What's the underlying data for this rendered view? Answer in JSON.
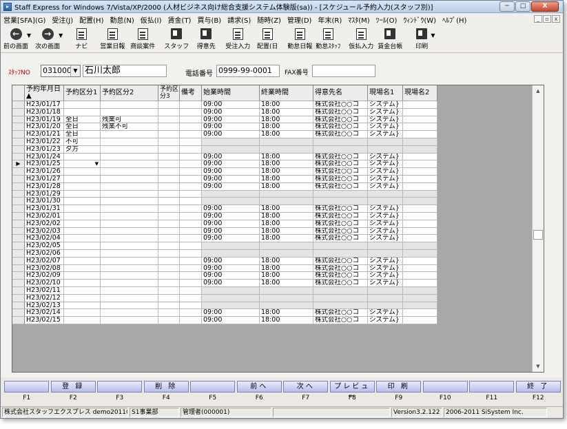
{
  "window": {
    "title": "Staff Express for Windows 7/Vista/XP/2000 (人材ビジネス向け総合支援システム体験版(sa)) - [スケジュール予約入力(スタッフ別)]",
    "controls": [
      "─",
      "□",
      "X"
    ]
  },
  "menubar": {
    "items": [
      "営業[SFA](G)",
      "受注(J)",
      "配置(H)",
      "勤怠(N)",
      "仮払(I)",
      "賃金(T)",
      "買与(B)",
      "請求(S)",
      "随時(Z)",
      "管理(D)",
      "年末(R)",
      "ﾏｽﾀ(M)",
      "ﾂｰﾙ(O)",
      "ｳｨﾝﾄﾞｳ(W)",
      "ﾍﾙﾌﾟ(H)"
    ],
    "mdi_controls": [
      "_",
      "▫",
      "x"
    ]
  },
  "toolbar": {
    "back": "前の画面",
    "forward": "次の画面",
    "navi": "ナビ",
    "sales_daily": "営業日報",
    "deal": "商談案件",
    "staff": "スタッフ",
    "customer": "得意先",
    "order_input": "受注入力",
    "placement": "配置(日",
    "attendance_daily": "勤怠日報",
    "attendance_staff": "勤怠ｽﾀｯﾌ",
    "advance_input": "仮払入力",
    "wage_ledger": "賃金台帳",
    "print": "印刷"
  },
  "form": {
    "staff_no_label": "ｽﾀｯﾌNO",
    "staff_no": "031000",
    "staff_name": "石川太郎",
    "tel_label": "電話番号",
    "tel": "0999-99-0001",
    "fax_label": "FAX番号",
    "fax": ""
  },
  "table": {
    "headers": [
      "予約年月日▲",
      "予約区分1",
      "予約区分2",
      "予約区分3",
      "備考",
      "始業時間",
      "終業時間",
      "得意先名",
      "現場名1",
      "現場名2"
    ],
    "rows": [
      [
        "H23/01/17",
        "",
        "",
        "",
        "",
        "09:00",
        "18:00",
        "株式会社○○コ",
        "システム}"
      ],
      [
        "H23/01/18",
        "",
        "",
        "",
        "",
        "09:00",
        "18:00",
        "株式会社○○コ",
        "システム}"
      ],
      [
        "H23/01/19",
        "全日",
        "残業可",
        "",
        "",
        "09:00",
        "18:00",
        "株式会社○○コ",
        "システム}"
      ],
      [
        "H23/01/20",
        "全日",
        "残業不可",
        "",
        "",
        "09:00",
        "18:00",
        "株式会社○○コ",
        "システム}"
      ],
      [
        "H23/01/21",
        "全日",
        "",
        "",
        "",
        "09:00",
        "18:00",
        "株式会社○○コ",
        "システム}"
      ],
      [
        "H23/01/22",
        "不可",
        "",
        "",
        "",
        "",
        "",
        "",
        ""
      ],
      [
        "H23/01/23",
        "夕方",
        "",
        "",
        "",
        "",
        "",
        "",
        ""
      ],
      [
        "H23/01/24",
        "",
        "",
        "",
        "",
        "09:00",
        "18:00",
        "株式会社○○コ",
        "システム}"
      ],
      [
        "H23/01/25",
        "",
        "",
        "",
        "",
        "09:00",
        "18:00",
        "株式会社○○コ",
        "システム}"
      ],
      [
        "H23/01/26",
        "",
        "",
        "",
        "",
        "09:00",
        "18:00",
        "株式会社○○コ",
        "システム}"
      ],
      [
        "H23/01/27",
        "",
        "",
        "",
        "",
        "09:00",
        "18:00",
        "株式会社○○コ",
        "システム}"
      ],
      [
        "H23/01/28",
        "",
        "",
        "",
        "",
        "09:00",
        "18:00",
        "株式会社○○コ",
        "システム}"
      ],
      [
        "H23/01/29",
        "",
        "",
        "",
        "",
        "",
        "",
        "",
        ""
      ],
      [
        "H23/01/30",
        "",
        "",
        "",
        "",
        "",
        "",
        "",
        ""
      ],
      [
        "H23/01/31",
        "",
        "",
        "",
        "",
        "09:00",
        "18:00",
        "株式会社○○コ",
        "システム}"
      ],
      [
        "H23/02/01",
        "",
        "",
        "",
        "",
        "09:00",
        "18:00",
        "株式会社○○コ",
        "システム}"
      ],
      [
        "H23/02/02",
        "",
        "",
        "",
        "",
        "09:00",
        "18:00",
        "株式会社○○コ",
        "システム}"
      ],
      [
        "H23/02/03",
        "",
        "",
        "",
        "",
        "09:00",
        "18:00",
        "株式会社○○コ",
        "システム}"
      ],
      [
        "H23/02/04",
        "",
        "",
        "",
        "",
        "09:00",
        "18:00",
        "株式会社○○コ",
        "システム}"
      ],
      [
        "H23/02/05",
        "",
        "",
        "",
        "",
        "",
        "",
        "",
        ""
      ],
      [
        "H23/02/06",
        "",
        "",
        "",
        "",
        "",
        "",
        "",
        ""
      ],
      [
        "H23/02/07",
        "",
        "",
        "",
        "",
        "09:00",
        "18:00",
        "株式会社○○コ",
        "システム}"
      ],
      [
        "H23/02/08",
        "",
        "",
        "",
        "",
        "09:00",
        "18:00",
        "株式会社○○コ",
        "システム}"
      ],
      [
        "H23/02/09",
        "",
        "",
        "",
        "",
        "09:00",
        "18:00",
        "株式会社○○コ",
        "システム}"
      ],
      [
        "H23/02/10",
        "",
        "",
        "",
        "",
        "09:00",
        "18:00",
        "株式会社○○コ",
        "システム}"
      ],
      [
        "H23/02/11",
        "",
        "",
        "",
        "",
        "",
        "",
        "",
        ""
      ],
      [
        "H23/02/12",
        "",
        "",
        "",
        "",
        "",
        "",
        "",
        ""
      ],
      [
        "H23/02/13",
        "",
        "",
        "",
        "",
        "",
        "",
        "",
        ""
      ],
      [
        "H23/02/14",
        "",
        "",
        "",
        "",
        "09:00",
        "18:00",
        "株式会社○○コ",
        "システム}"
      ],
      [
        "H23/02/15",
        "",
        "",
        "",
        "",
        "09:00",
        "18:00",
        "株式会社○○コ",
        "システム}"
      ]
    ],
    "current_row_index": 8,
    "row_indicator": "▶",
    "dropdown_arrow": "▼"
  },
  "fkeys": [
    {
      "label": "",
      "key": "F1"
    },
    {
      "label": "登 録",
      "key": "F2"
    },
    {
      "label": "",
      "key": "F3"
    },
    {
      "label": "削 除",
      "key": "F4"
    },
    {
      "label": "",
      "key": "F5"
    },
    {
      "label": "前へ",
      "key": "F6"
    },
    {
      "label": "次へ",
      "key": "F7"
    },
    {
      "label": "プレビュー",
      "key": "F8"
    },
    {
      "label": "印 刷",
      "key": "F9"
    },
    {
      "label": "",
      "key": "F10"
    },
    {
      "label": "",
      "key": "F11"
    },
    {
      "label": "終 了",
      "key": "F12"
    }
  ],
  "statusbar": {
    "company": "株式会社スタッフエクスプレス demo201101",
    "dept": "S1事業部",
    "user": "管理者(000001)",
    "blank": "",
    "version": "Version3.2.122",
    "copyright": "2006-2011 SiSystem Inc."
  }
}
